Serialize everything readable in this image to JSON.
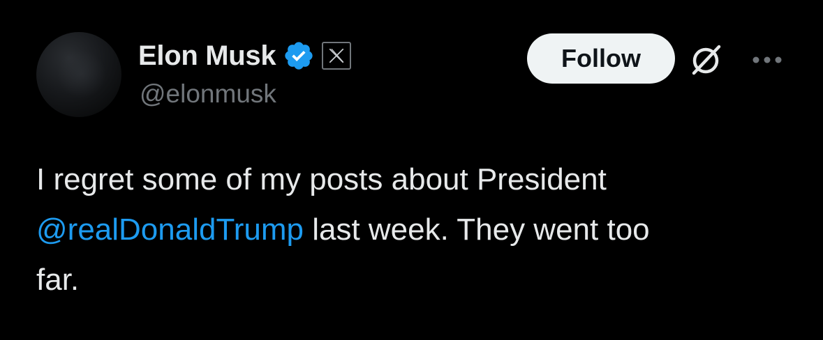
{
  "author": {
    "display_name": "Elon Musk",
    "handle": "@elonmusk",
    "verified_icon": "verified-badge-icon",
    "affiliation_icon": "x-logo-icon"
  },
  "actions": {
    "follow_label": "Follow",
    "grok_icon": "grok-icon",
    "more_icon": "more-options-icon"
  },
  "tweet": {
    "line1": "I regret some of my posts about President",
    "mention": "@realDonaldTrump",
    "line2_rest": " last week. They went too",
    "line3": "far."
  },
  "colors": {
    "background": "#000000",
    "text_primary": "#e7e9ea",
    "text_secondary": "#71767b",
    "accent_blue": "#1d9bf0",
    "follow_bg": "#eff3f4"
  }
}
